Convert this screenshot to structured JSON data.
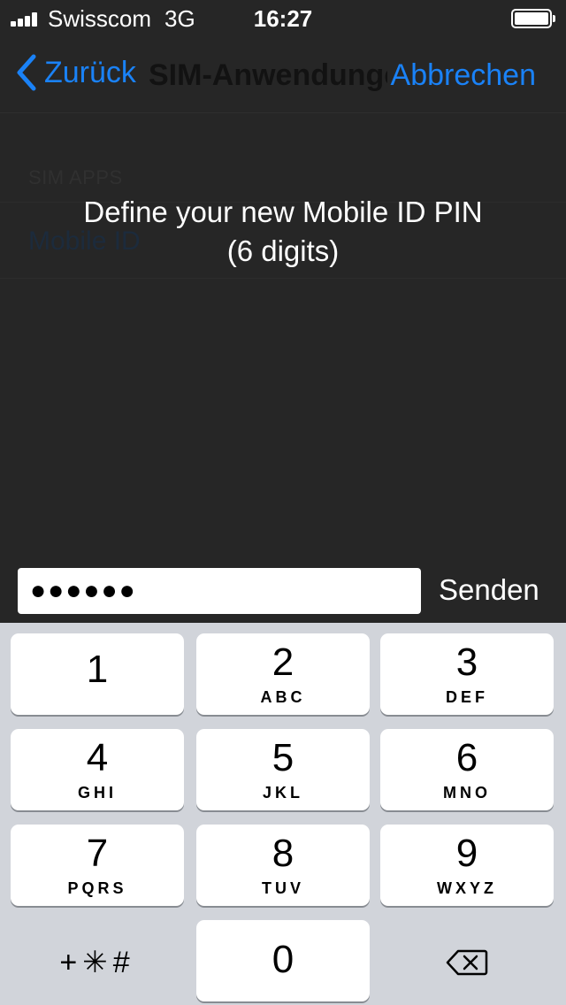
{
  "status_bar": {
    "carrier": "Swisscom",
    "network": "3G",
    "time": "16:27"
  },
  "nav": {
    "back_label": "Zurück",
    "title": "SIM-Anwendungen",
    "cancel_label": "Abbrechen"
  },
  "list": {
    "section_header": "SIM APPS",
    "items": [
      "Mobile ID"
    ]
  },
  "prompt": {
    "line1": "Define your new Mobile ID PIN",
    "line2": "(6 digits)"
  },
  "pin_input": {
    "value": "●●●●●●"
  },
  "send_label": "Senden",
  "keypad": {
    "keys": [
      {
        "digit": "1",
        "letters": ""
      },
      {
        "digit": "2",
        "letters": "ABC"
      },
      {
        "digit": "3",
        "letters": "DEF"
      },
      {
        "digit": "4",
        "letters": "GHI"
      },
      {
        "digit": "5",
        "letters": "JKL"
      },
      {
        "digit": "6",
        "letters": "MNO"
      },
      {
        "digit": "7",
        "letters": "PQRS"
      },
      {
        "digit": "8",
        "letters": "TUV"
      },
      {
        "digit": "9",
        "letters": "WXYZ"
      },
      {
        "digit": "0",
        "letters": ""
      }
    ],
    "symbols_label": "+✳#"
  },
  "colors": {
    "accent": "#1a82f7",
    "overlay_background": "#262626",
    "keypad_background": "#d1d4da"
  }
}
